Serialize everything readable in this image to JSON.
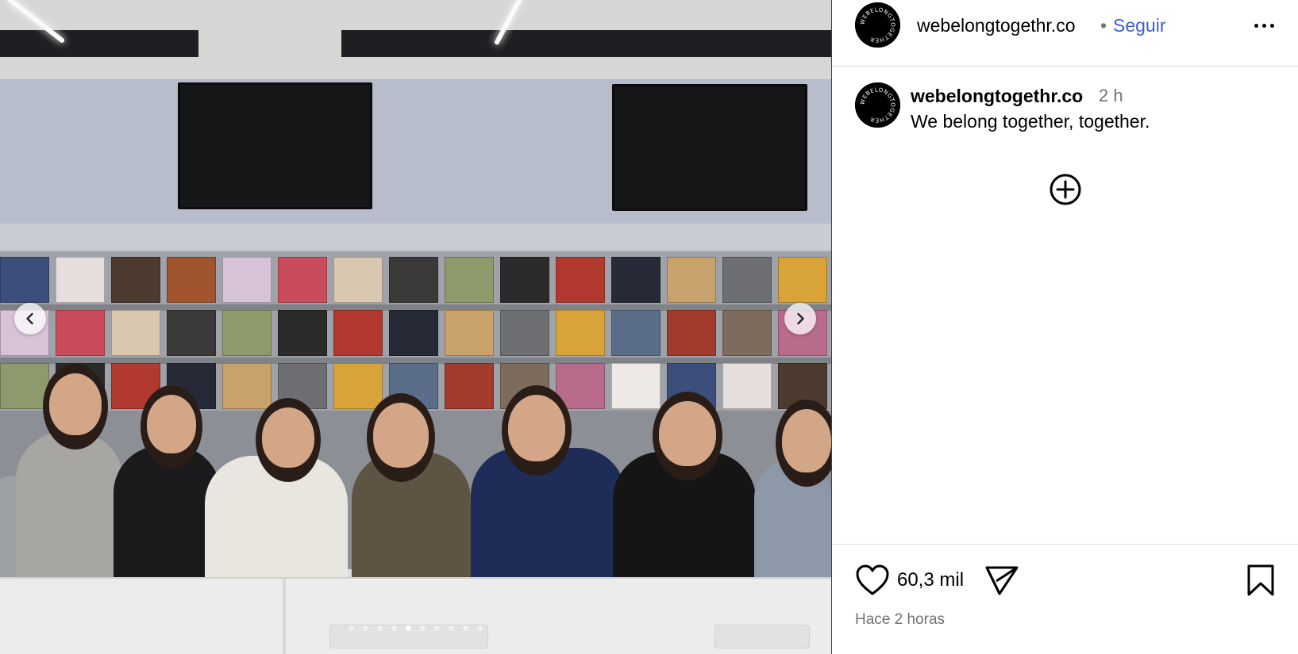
{
  "post": {
    "username": "webelongtogethr.co",
    "separator": "•",
    "follow_label": "Seguir",
    "caption_time": "2 h",
    "caption_text": "We belong together, together.",
    "likes": "60,3 mil",
    "time_ago": "Hace 2 horas",
    "avatar_text": "WEBELONGTOGETHER"
  },
  "carousel": {
    "slide_count": 10,
    "active_index": 4
  },
  "icons": {
    "more": "more-options-icon",
    "prev": "chevron-left-icon",
    "next": "chevron-right-icon",
    "add": "add-comment-plus-icon",
    "like": "heart-icon",
    "share": "share-paper-plane-icon",
    "save": "bookmark-icon"
  },
  "colors": {
    "follow": "#3a5fd6",
    "muted": "#737373",
    "divider": "#dbdbdb"
  }
}
